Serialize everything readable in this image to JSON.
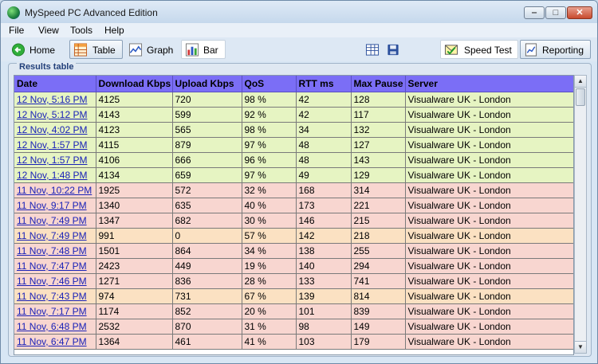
{
  "window": {
    "title": "MySpeed PC Advanced Edition"
  },
  "menu": {
    "items": [
      "File",
      "View",
      "Tools",
      "Help"
    ]
  },
  "toolbar": {
    "home_label": "Home",
    "table_label": "Table",
    "graph_label": "Graph",
    "bar_label": "Bar",
    "speed_test_label": "Speed Test",
    "reporting_label": "Reporting"
  },
  "results": {
    "title": "Results table",
    "columns": [
      "Date",
      "Download Kbps",
      "Upload Kbps",
      "QoS",
      "RTT ms",
      "Max Pause",
      "Server"
    ],
    "rows": [
      [
        "12 Nov, 5:16 PM",
        "4125",
        "720",
        "98 %",
        "42",
        "128",
        "Visualware UK - London"
      ],
      [
        "12 Nov, 5:12 PM",
        "4143",
        "599",
        "92 %",
        "42",
        "117",
        "Visualware UK - London"
      ],
      [
        "12 Nov, 4:02 PM",
        "4123",
        "565",
        "98 %",
        "34",
        "132",
        "Visualware UK - London"
      ],
      [
        "12 Nov, 1:57 PM",
        "4115",
        "879",
        "97 %",
        "48",
        "127",
        "Visualware UK - London"
      ],
      [
        "12 Nov, 1:57 PM",
        "4106",
        "666",
        "96 %",
        "48",
        "143",
        "Visualware UK - London"
      ],
      [
        "12 Nov, 1:48 PM",
        "4134",
        "659",
        "97 %",
        "49",
        "129",
        "Visualware UK - London"
      ],
      [
        "11 Nov, 10:22 PM",
        "1925",
        "572",
        "32 %",
        "168",
        "314",
        "Visualware UK - London"
      ],
      [
        "11 Nov, 9:17 PM",
        "1340",
        "635",
        "40 %",
        "173",
        "221",
        "Visualware UK - London"
      ],
      [
        "11 Nov, 7:49 PM",
        "1347",
        "682",
        "30 %",
        "146",
        "215",
        "Visualware UK - London"
      ],
      [
        "11 Nov, 7:49 PM",
        "991",
        "0",
        "57 %",
        "142",
        "218",
        "Visualware UK - London"
      ],
      [
        "11 Nov, 7:48 PM",
        "1501",
        "864",
        "34 %",
        "138",
        "255",
        "Visualware UK - London"
      ],
      [
        "11 Nov, 7:47 PM",
        "2423",
        "449",
        "19 %",
        "140",
        "294",
        "Visualware UK - London"
      ],
      [
        "11 Nov, 7:46 PM",
        "1271",
        "836",
        "28 %",
        "133",
        "741",
        "Visualware UK - London"
      ],
      [
        "11 Nov, 7:43 PM",
        "974",
        "731",
        "67 %",
        "139",
        "814",
        "Visualware UK - London"
      ],
      [
        "11 Nov, 7:17 PM",
        "1174",
        "852",
        "20 %",
        "101",
        "839",
        "Visualware UK - London"
      ],
      [
        "11 Nov, 6:48 PM",
        "2532",
        "870",
        "31 %",
        "98",
        "149",
        "Visualware UK - London"
      ],
      [
        "11 Nov, 6:47 PM",
        "1364",
        "461",
        "41 %",
        "103",
        "179",
        "Visualware UK - London"
      ]
    ],
    "row_status": [
      "green",
      "green",
      "green",
      "green",
      "green",
      "green",
      "red",
      "red",
      "red",
      "orange",
      "red",
      "red",
      "red",
      "orange",
      "red",
      "red",
      "red"
    ]
  },
  "colors": {
    "header_bg": "#7b6ef6",
    "row_good": "#e6f4c2",
    "row_bad": "#f8d6d0",
    "row_warn": "#fbe1c2",
    "link": "#1a22b8"
  }
}
